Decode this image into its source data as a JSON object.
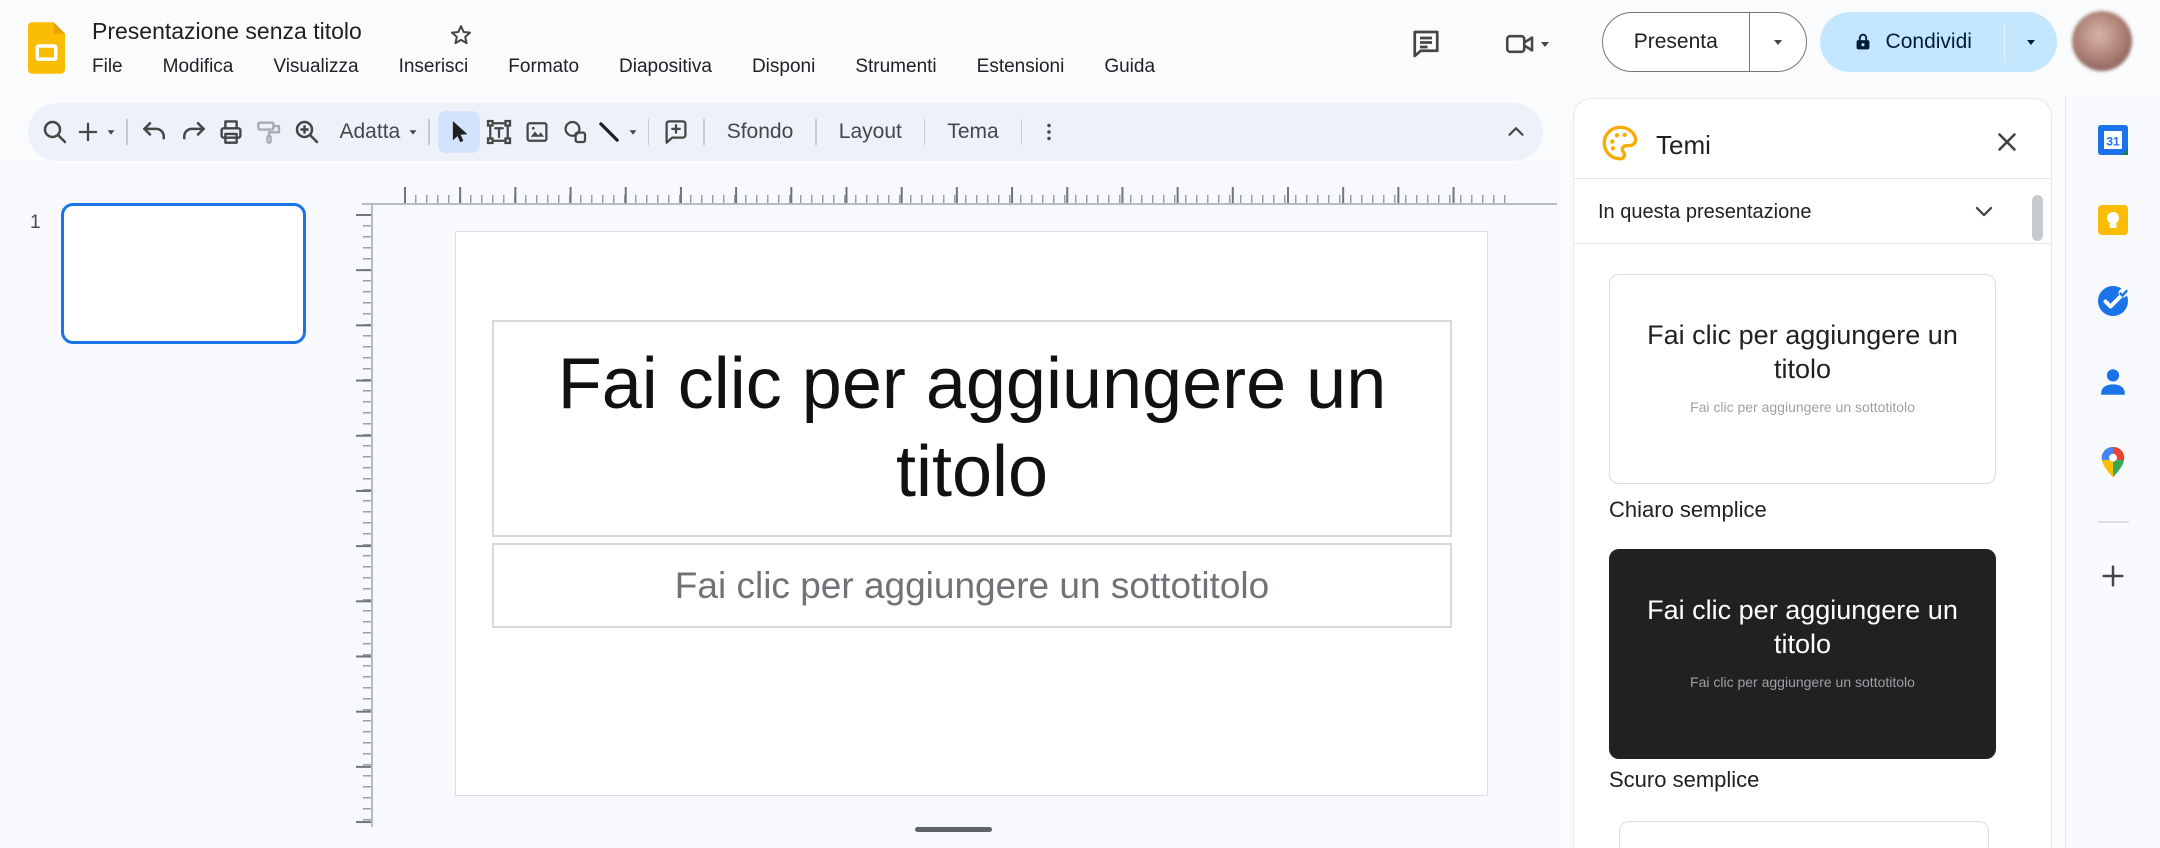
{
  "header": {
    "title": "Presentazione senza titolo",
    "menus": [
      "File",
      "Modifica",
      "Visualizza",
      "Inserisci",
      "Formato",
      "Diapositiva",
      "Disponi",
      "Strumenti",
      "Estensioni",
      "Guida"
    ],
    "present_label": "Presenta",
    "share_label": "Condividi"
  },
  "toolbar": {
    "fit_label": "Adatta",
    "background_label": "Sfondo",
    "layout_label": "Layout",
    "theme_label": "Tema"
  },
  "filmstrip": {
    "slide_number": "1"
  },
  "slide": {
    "title_placeholder": "Fai clic per aggiungere un titolo",
    "subtitle_placeholder": "Fai clic per aggiungere un sottotitolo"
  },
  "themes_panel": {
    "title": "Temi",
    "section_label": "In questa presentazione",
    "themes": [
      {
        "name": "Chiaro semplice",
        "variant": "light",
        "title_placeholder": "Fai clic per aggiungere un titolo",
        "subtitle_placeholder": "Fai clic per aggiungere un sottotitolo"
      },
      {
        "name": "Scuro semplice",
        "variant": "dark",
        "title_placeholder": "Fai clic per aggiungere un titolo",
        "subtitle_placeholder": "Fai clic per aggiungere un sottotitolo"
      }
    ]
  },
  "side_rail": {
    "icons": [
      "calendar",
      "keep",
      "tasks",
      "contacts",
      "maps",
      "get-addons"
    ]
  },
  "colors": {
    "share_button_bg": "#c2e7ff",
    "share_button_text": "#001d35",
    "selected_tool_bg": "#d3e3fd",
    "thumbnail_border": "#1a73e8",
    "dark_theme_bg": "#212121",
    "toolbar_bg": "#edf2fa",
    "logo_yellow": "#fbbc04"
  }
}
